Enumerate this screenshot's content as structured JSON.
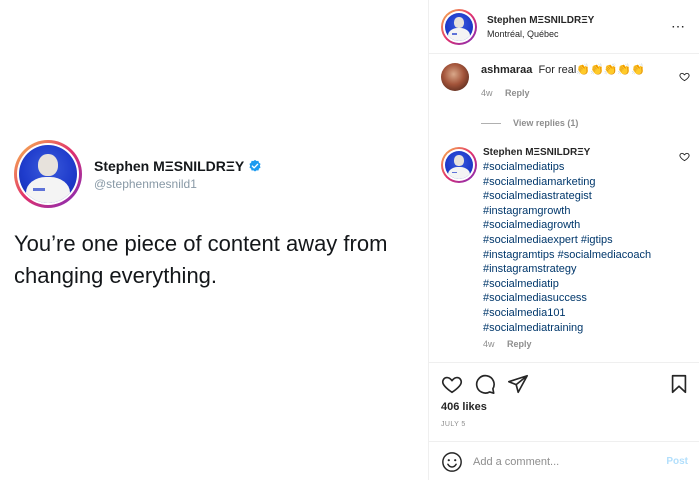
{
  "tweet": {
    "name": "Stephen MΞSNILDRΞY",
    "handle": "@stephenmesnild1",
    "text": "You’re one piece of content away from changing everything."
  },
  "header": {
    "username": "Stephen MΞSNILDRΞY",
    "location": "Montréal, Québec",
    "more_icon": "⋯"
  },
  "comment1": {
    "username": "ashmaraa",
    "text": "For real👏👏👏👏👏",
    "age": "4w",
    "reply_label": "Reply",
    "view_replies": "View replies (1)"
  },
  "caption": {
    "username": "Stephen MΞSNILDRΞY",
    "hashtags": [
      "#socialmediatips",
      "#socialmediamarketing",
      "#socialmediastrategist",
      "#instagramgrowth",
      "#socialmediagrowth",
      "#socialmediaexpert #igtips",
      "#instagramtips #socialmediacoach",
      "#instagramstrategy",
      "#socialmediatip",
      "#socialmediasuccess",
      "#socialmedia101",
      "#socialmediatraining"
    ],
    "age": "4w",
    "reply_label": "Reply"
  },
  "actions": {
    "likes": "406 likes",
    "date": "JULY 5"
  },
  "add_comment": {
    "placeholder": "Add a comment...",
    "post_label": "Post"
  },
  "colors": {
    "verified": "#1d9bf0",
    "hashtag": "#00376b",
    "muted": "#8e8e8e",
    "post_disabled": "#b2dffc"
  },
  "icons": {
    "header_more": "more-icon",
    "verified": "verified-badge-icon",
    "like": "heart-icon",
    "comment": "comment-bubble-icon",
    "share": "paper-plane-icon",
    "save": "bookmark-icon",
    "emoji": "emoji-icon"
  }
}
